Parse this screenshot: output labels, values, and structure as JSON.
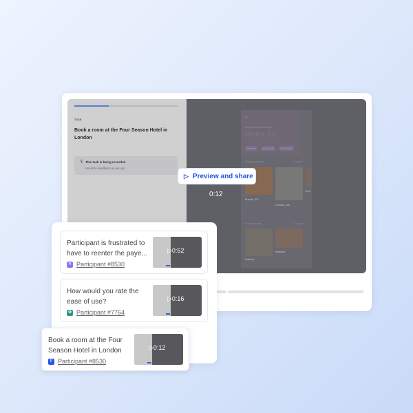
{
  "player": {
    "task_label": "TASK",
    "task_title": "Book a room at the Four Season Hotel in London",
    "recording_title": "This task is being recorded",
    "recording_subtitle": "Vocalize feedback as you go.",
    "progress_percent": 33,
    "preview_button": "Preview and share",
    "time": "0:12",
    "app": {
      "explore_label": "Explore apartments in",
      "location": "Madrid, ES",
      "chips": [
        "2 People",
        "Up to £100",
        "City Centre"
      ],
      "popular": "Popular places",
      "explore": "Explore",
      "place1": "Madrid, ES",
      "place2": "London, UK",
      "place3": "Berl",
      "country": "In my country",
      "place4": "Warsaw",
      "place5": "Krakow"
    }
  },
  "clips": [
    {
      "text": "Participant is frustrated to have to reenter the paye...",
      "line1": "Participant is frustrated to",
      "line2": "have to reenter the paye...",
      "participant": "Participant #8530",
      "duration": "0:52",
      "badge_color": "#8b7cf6",
      "badge": "✕"
    },
    {
      "text": "How would you rate the ease of use?",
      "line1": "How would you rate the",
      "line2": "ease of use?",
      "participant": "Participant #7764",
      "duration": "0:16",
      "badge_color": "#2a9d8f",
      "badge": "✿"
    },
    {
      "text": "Book a room at the Four Season Hotel in London",
      "line1": "Book a room at the Four",
      "line2": "Season Hotel in London",
      "participant": "Participant #8530",
      "duration": "0:12",
      "badge_color": "#2354e6",
      "badge": "P"
    }
  ]
}
